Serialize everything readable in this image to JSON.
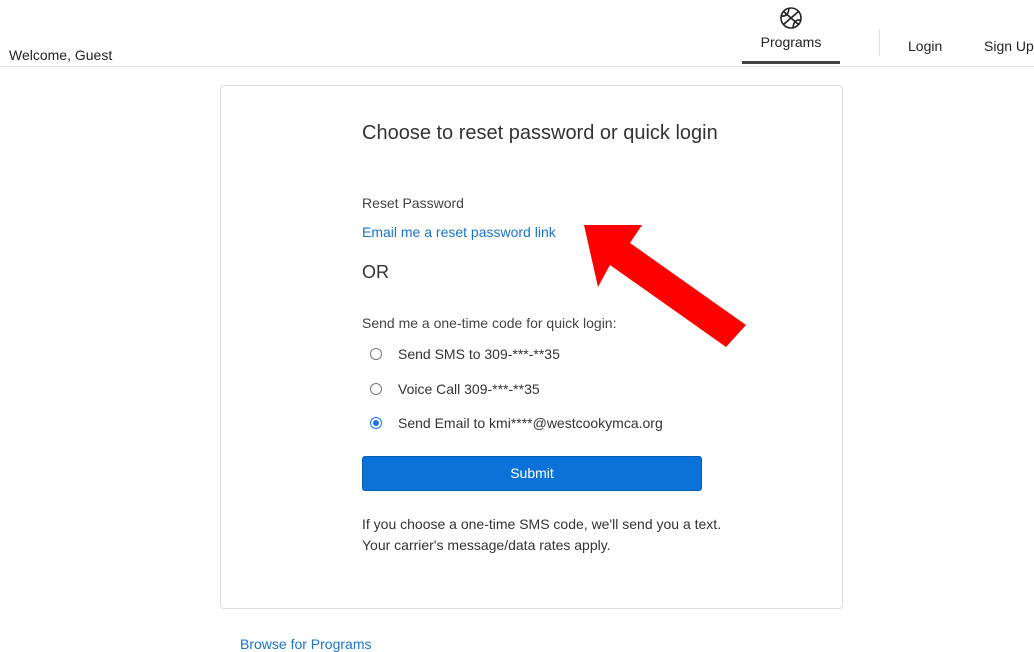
{
  "header": {
    "welcome": "Welcome, Guest",
    "nav": {
      "programs": "Programs",
      "login": "Login",
      "signup": "Sign Up"
    },
    "programs_icon": "basketball-icon"
  },
  "card": {
    "title": "Choose to reset password or quick login",
    "reset_label": "Reset Password",
    "reset_link": "Email me a reset password link",
    "or": "OR",
    "send_label": "Send me a one-time code for quick login:",
    "options": [
      {
        "label": "Send SMS to 309-***-**35",
        "selected": false
      },
      {
        "label": "Voice Call 309-***-**35",
        "selected": false
      },
      {
        "label": "Send Email to kmi****@westcookymca.org",
        "selected": true
      }
    ],
    "submit": "Submit",
    "disclaimer": "If you choose a one-time SMS code, we'll send you a text. Your carrier's message/data rates apply."
  },
  "footer": {
    "browse": "Browse for Programs"
  },
  "colors": {
    "accent": "#0a72d8",
    "link": "#1a73c9",
    "annotation_arrow": "#ff0000"
  }
}
